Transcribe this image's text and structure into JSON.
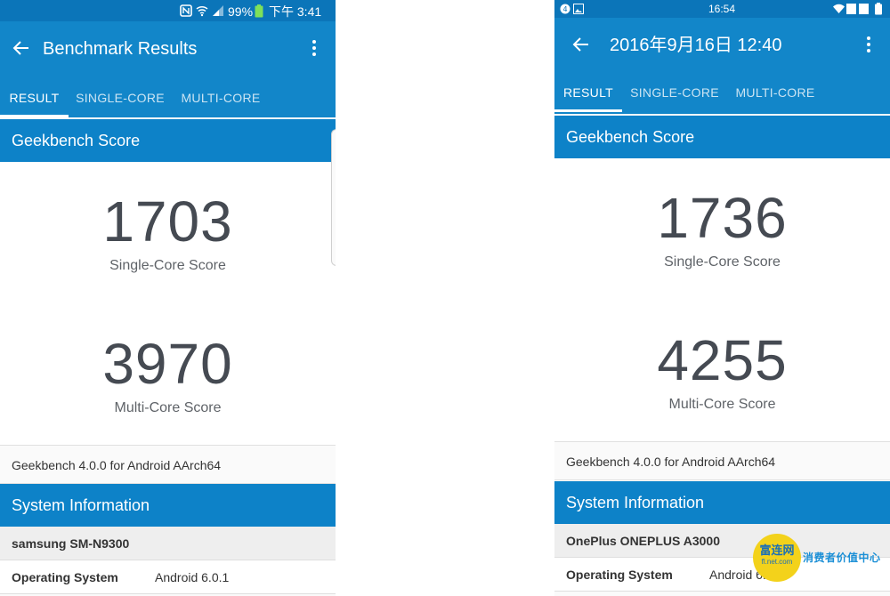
{
  "left": {
    "status_bar": {
      "battery": "99%",
      "time": "下午 3:41"
    },
    "app_bar": {
      "title": "Benchmark Results"
    },
    "tabs": [
      "RESULT",
      "SINGLE-CORE",
      "MULTI-CORE"
    ],
    "section": "Geekbench Score",
    "single_core_score": "1703",
    "single_core_label": "Single-Core Score",
    "multi_core_score": "3970",
    "multi_core_label": "Multi-Core Score",
    "version": "Geekbench 4.0.0 for Android AArch64",
    "system_info_header": "System Information",
    "device": "samsung SM-N9300",
    "os_key": "Operating System",
    "os_value": "Android 6.0.1"
  },
  "right": {
    "status_bar": {
      "time": "16:54"
    },
    "app_bar": {
      "title": "2016年9月16日 12:40"
    },
    "tabs": [
      "RESULT",
      "SINGLE-CORE",
      "MULTI-CORE"
    ],
    "section": "Geekbench Score",
    "single_core_score": "1736",
    "single_core_label": "Single-Core Score",
    "multi_core_score": "4255",
    "multi_core_label": "Multi-Core Score",
    "version": "Geekbench 4.0.0 for Android AArch64",
    "system_info_header": "System Information",
    "device": "OnePlus ONEPLUS A3000",
    "os_key": "Operating System",
    "os_value": "Android 6.0.1"
  },
  "watermark": {
    "logo_text": "富连网",
    "logo_subtext": "fl.net.com",
    "slogan": "消费者价值中心"
  },
  "colors": {
    "statusbar": "#0b75b9",
    "appbar": "#1286c9",
    "section_header": "#0d82c8",
    "score_text": "#454a52"
  }
}
